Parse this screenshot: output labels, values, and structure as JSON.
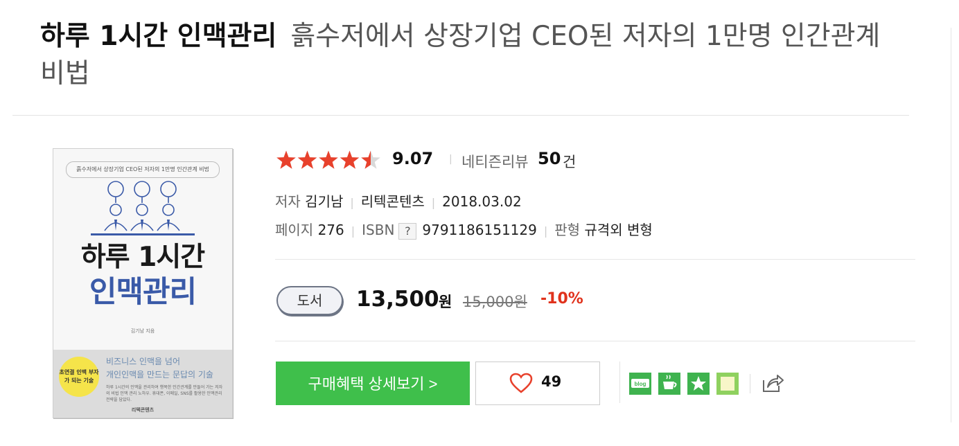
{
  "product": {
    "title": "하루 1시간 인맥관리",
    "subtitle": "흙수저에서 상장기업 CEO된 저자의 1만명 인간관계 비법"
  },
  "cover": {
    "top_banner": "흙수저에서 상장기업 CEO된 저자의 1만명 인간관계 비법",
    "title_line1": "하루 1시간",
    "title_line2": "인맥관리",
    "author": "김기남 지음",
    "badge": "초연결 인맥 부자가 되는 기술",
    "slogan_line1": "비즈니스 인맥을 넘어",
    "slogan_line2": "개인인맥을 만드는 문답의 기술",
    "small_text": "하루 1시간의 인맥을 관리하여 행복한 인간관계를 만들어 가는 저자의 비법 인맥 관리 노하우. 휴대폰, 이메일, SNS를 활용한 인맥관리 전략을 담았다.",
    "publisher": "리텍콘텐츠"
  },
  "rating": {
    "stars": 4.5,
    "score": "9.07",
    "review_label": "네티즌리뷰",
    "review_count": "50",
    "review_unit": "건",
    "star_color": "#e8412c"
  },
  "meta": {
    "author_label": "저자",
    "author": "김기남",
    "publisher": "리텍콘텐츠",
    "date": "2018.03.02",
    "pages_label": "페이지",
    "pages": "276",
    "isbn_label": "ISBN",
    "isbn_help": "?",
    "isbn": "9791186151129",
    "format_label": "판형",
    "format": "규격외 변형"
  },
  "price": {
    "type": "도서",
    "sale": "13,500",
    "unit": "원",
    "original": "15,000원",
    "discount": "-10%"
  },
  "actions": {
    "buy_label": "구매혜택 상세보기 >",
    "like_count": "49",
    "buy_color": "#3fbf4b"
  },
  "share": {
    "icons": [
      "blog-icon",
      "cafe-icon",
      "bookmark-star-icon",
      "memo-icon",
      "share-export-icon"
    ]
  }
}
